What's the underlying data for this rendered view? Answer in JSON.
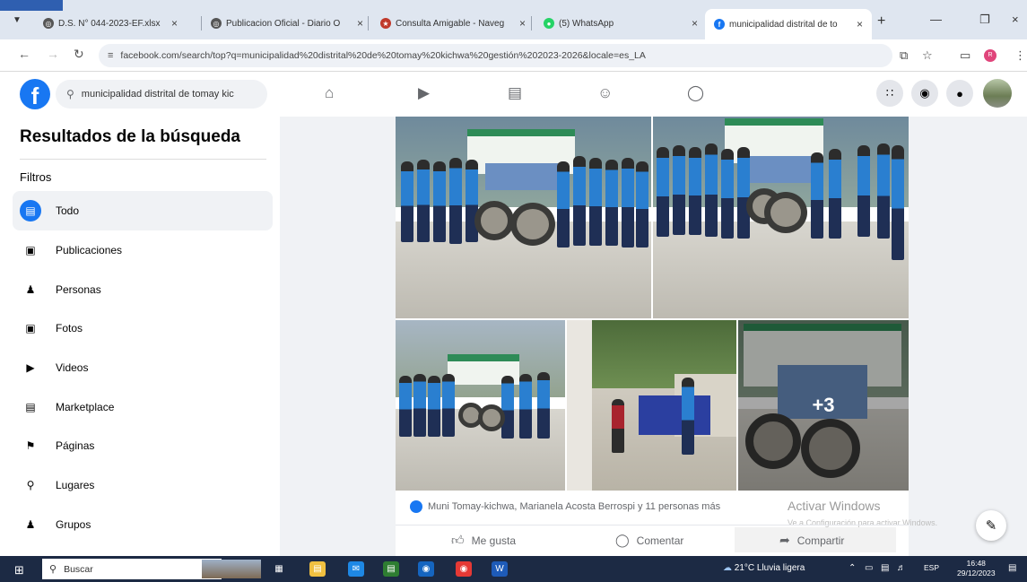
{
  "browser": {
    "tabs": [
      {
        "title": "D.S. N° 044-2023-EF.xlsx",
        "icon": "globe-icon"
      },
      {
        "title": "Publicacion Oficial - Diario O",
        "icon": "globe-icon"
      },
      {
        "title": "Consulta Amigable - Naveg",
        "icon": "mef-icon"
      },
      {
        "title": "(5) WhatsApp",
        "icon": "whatsapp-icon"
      },
      {
        "title": "municipalidad distrital de to",
        "icon": "facebook-icon",
        "active": true
      }
    ],
    "url": "facebook.com/search/top?q=municipalidad%20distrital%20de%20tomay%20kichwa%20gestión%202023-2026&locale=es_LA"
  },
  "facebook": {
    "logo": "f",
    "search_value": "municipalidad distrital de tomay kic",
    "brand_color": "#1877f2"
  },
  "sidebar": {
    "title": "Resultados de la búsqueda",
    "filters_label": "Filtros",
    "items": [
      {
        "label": "Todo",
        "icon": "feed-icon",
        "active": true
      },
      {
        "label": "Publicaciones",
        "icon": "comment-icon"
      },
      {
        "label": "Personas",
        "icon": "people-icon"
      },
      {
        "label": "Fotos",
        "icon": "photo-icon"
      },
      {
        "label": "Videos",
        "icon": "video-icon"
      },
      {
        "label": "Marketplace",
        "icon": "store-icon"
      },
      {
        "label": "Páginas",
        "icon": "flag-icon"
      },
      {
        "label": "Lugares",
        "icon": "location-icon"
      },
      {
        "label": "Grupos",
        "icon": "groups-icon"
      }
    ]
  },
  "post": {
    "more_photos": "+3",
    "reactions_text": "Muni Tomay-kichwa, Marianela Acosta Berrospi y 11 personas más",
    "like_label": "Me gusta",
    "comment_label": "Comentar",
    "share_label": "Compartir"
  },
  "watermark": {
    "title": "Activar Windows",
    "subtitle": "Ve a Configuración para activar Windows."
  },
  "taskbar": {
    "search_placeholder": "Buscar",
    "weather": "21°C  Lluvia ligera",
    "lang": "ESP",
    "time": "16:48",
    "date": "29/12/2023"
  }
}
